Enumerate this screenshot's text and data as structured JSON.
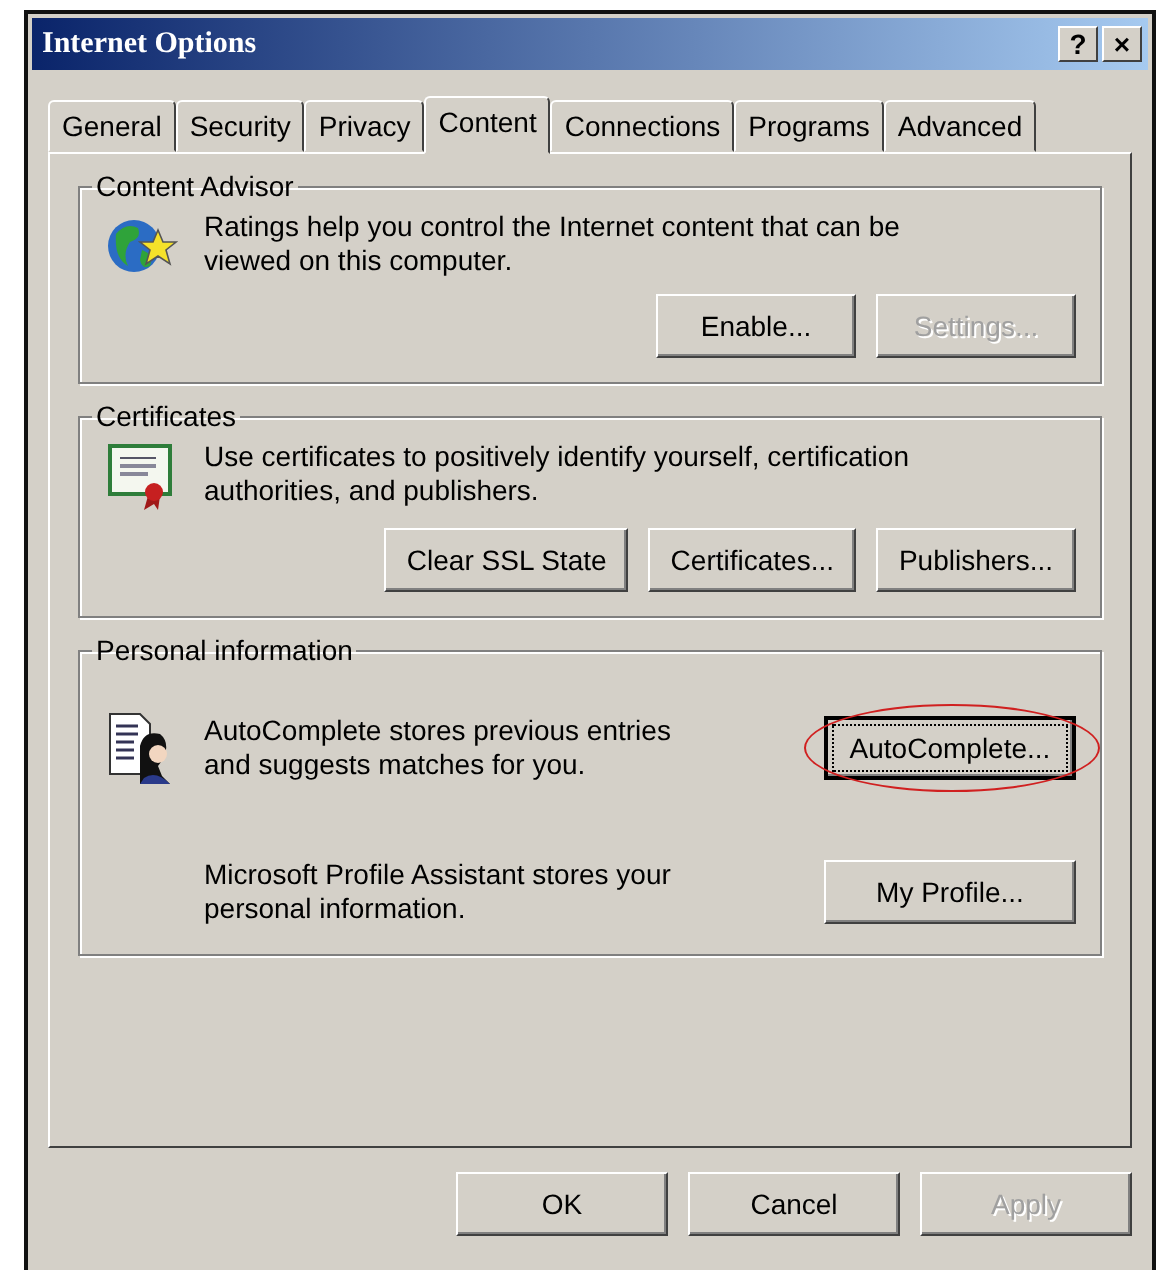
{
  "window": {
    "title": "Internet Options",
    "title_buttons": [
      "?",
      "×"
    ]
  },
  "tabs": [
    {
      "label": "General",
      "selected": false
    },
    {
      "label": "Security",
      "selected": false
    },
    {
      "label": "Privacy",
      "selected": false
    },
    {
      "label": "Content",
      "selected": true
    },
    {
      "label": "Connections",
      "selected": false
    },
    {
      "label": "Programs",
      "selected": false
    },
    {
      "label": "Advanced",
      "selected": false
    }
  ],
  "groups": [
    {
      "title": "Content Advisor",
      "kind": "stacked",
      "entries": [
        {
          "kind": "globe-star",
          "text": "Ratings help you control the Internet content that can be viewed on this computer.",
          "buttons": [
            {
              "label": "Enable...",
              "disabled": false,
              "focused": false,
              "circled": false
            },
            {
              "label": "Settings...",
              "disabled": true,
              "focused": false,
              "circled": false
            }
          ]
        }
      ]
    },
    {
      "title": "Certificates",
      "kind": "stacked",
      "entries": [
        {
          "kind": "certificate",
          "text": "Use certificates to positively identify yourself, certification authorities, and publishers.",
          "buttons": [
            {
              "label": "Clear SSL State",
              "disabled": false,
              "focused": false,
              "circled": false
            },
            {
              "label": "Certificates...",
              "disabled": false,
              "focused": false,
              "circled": false
            },
            {
              "label": "Publishers...",
              "disabled": false,
              "focused": false,
              "circled": false
            }
          ]
        }
      ]
    },
    {
      "title": "Personal information",
      "kind": "side",
      "entries": [
        {
          "kind": "document-person",
          "text": "AutoComplete stores previous entries and suggests matches for you.",
          "buttons": [
            {
              "label": "AutoComplete...",
              "disabled": false,
              "focused": true,
              "circled": true
            }
          ]
        },
        {
          "kind": "plain",
          "text": "Microsoft Profile Assistant stores your personal information.",
          "buttons": [
            {
              "label": "My Profile...",
              "disabled": false,
              "focused": false,
              "circled": false
            }
          ]
        }
      ]
    }
  ],
  "footer_buttons": [
    {
      "label": "OK",
      "disabled": false
    },
    {
      "label": "Cancel",
      "disabled": false
    },
    {
      "label": "Apply",
      "disabled": true
    }
  ]
}
